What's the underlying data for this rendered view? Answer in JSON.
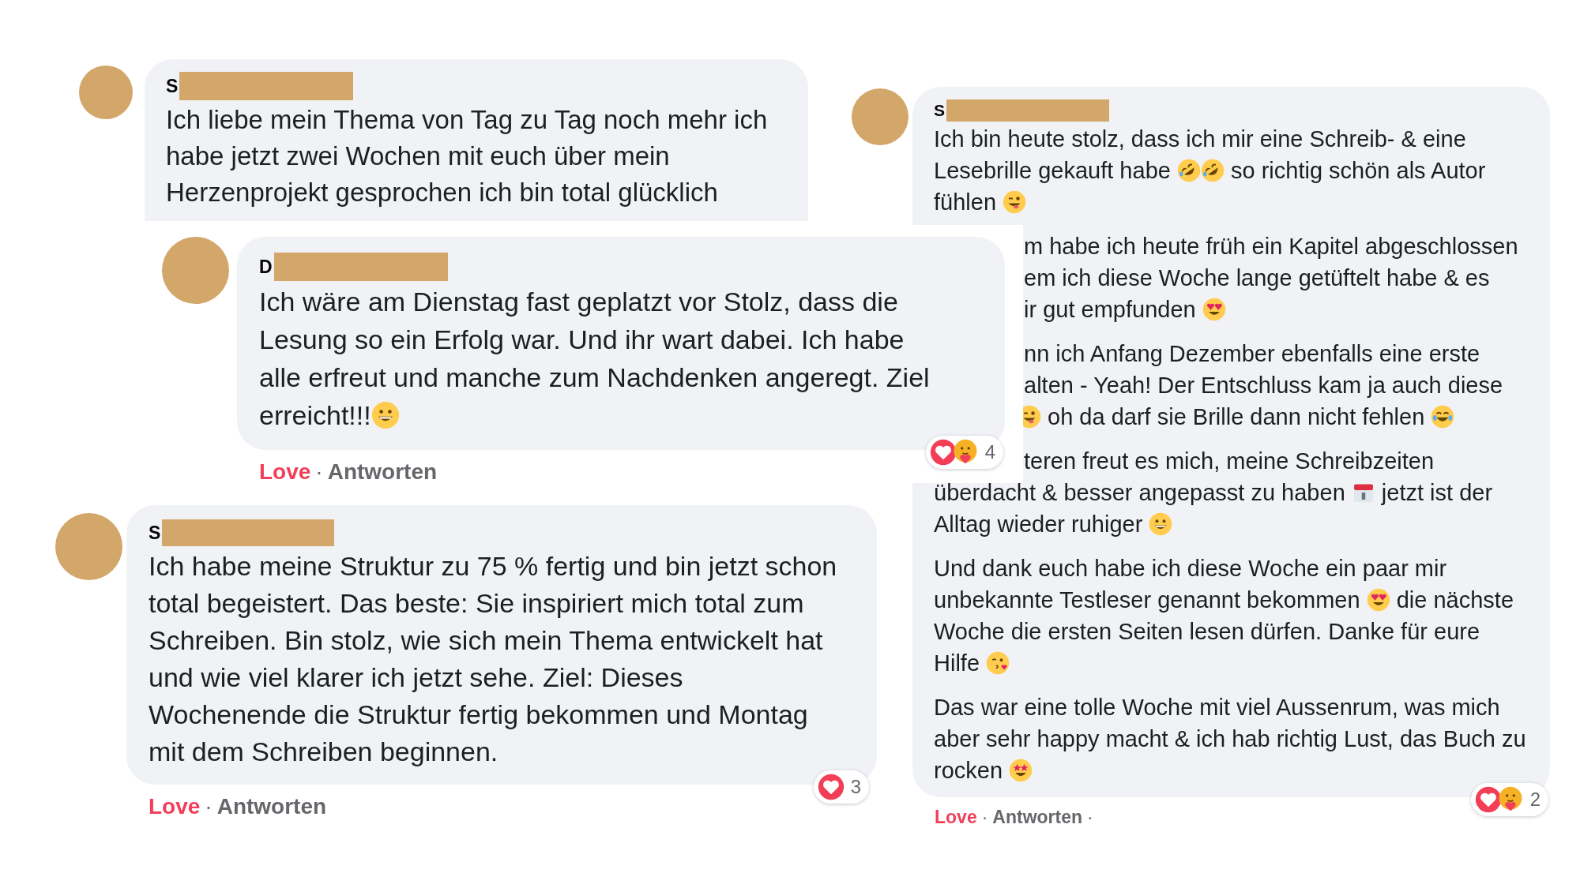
{
  "comments": [
    {
      "author": "S",
      "paragraphs": [
        {
          "lines": [
            {
              "segments": [
                {
                  "text": "Ich liebe mein Thema von Tag zu Tag noch mehr ich"
                }
              ]
            },
            {
              "segments": [
                {
                  "text": "habe jetzt zwei Wochen mit euch über mein"
                }
              ]
            },
            {
              "segments": [
                {
                  "text": "Herzenprojekt gesprochen ich bin total glücklich"
                }
              ]
            }
          ]
        }
      ]
    },
    {
      "author": "D",
      "paragraphs": [
        {
          "lines": [
            {
              "segments": [
                {
                  "text": "Ich wäre am Dienstag fast geplatzt vor Stolz, dass die"
                }
              ]
            },
            {
              "segments": [
                {
                  "text": "Lesung so ein Erfolg war. Und ihr wart dabei. Ich habe"
                }
              ]
            },
            {
              "segments": [
                {
                  "text": "alle erfreut und manche zum Nachdenken angeregt. Ziel"
                }
              ]
            },
            {
              "segments": [
                {
                  "text": "erreicht!!!"
                },
                {
                  "kind": "grin"
                }
              ]
            }
          ]
        }
      ],
      "actions": [
        {
          "kind": "reaction",
          "text": "Love"
        },
        {
          "kind": "dot",
          "text": "·"
        },
        {
          "kind": "link",
          "text": "Antworten"
        }
      ],
      "reactions": {
        "icons": [
          {
            "kind": "love"
          },
          {
            "kind": "care"
          }
        ],
        "count": "4"
      }
    },
    {
      "author": "S",
      "paragraphs": [
        {
          "lines": [
            {
              "segments": [
                {
                  "text": "Ich habe meine Struktur zu 75 % fertig und bin jetzt schon"
                }
              ]
            },
            {
              "segments": [
                {
                  "text": "total begeistert. Das beste: Sie inspiriert mich total zum"
                }
              ]
            },
            {
              "segments": [
                {
                  "text": "Schreiben. Bin stolz, wie sich mein Thema entwickelt hat"
                }
              ]
            },
            {
              "segments": [
                {
                  "text": "und wie viel klarer ich jetzt sehe. Ziel: Dieses"
                }
              ]
            },
            {
              "segments": [
                {
                  "text": "Wochenende die Struktur fertig bekommen und Montag"
                }
              ]
            },
            {
              "segments": [
                {
                  "text": "mit dem Schreiben beginnen."
                }
              ]
            }
          ]
        }
      ],
      "actions": [
        {
          "kind": "reaction",
          "text": "Love"
        },
        {
          "kind": "dot",
          "text": "·"
        },
        {
          "kind": "link",
          "text": "Antworten"
        }
      ],
      "reactions": {
        "icons": [
          {
            "kind": "love"
          }
        ],
        "count": "3"
      }
    },
    {
      "author": "S",
      "paragraphs": [
        {
          "lines": [
            {
              "segments": [
                {
                  "text": "Ich bin heute stolz, dass ich mir eine Schreib- & eine"
                }
              ]
            },
            {
              "segments": [
                {
                  "text": "Lesebrille gekauft habe "
                },
                {
                  "kind": "rofl"
                },
                {
                  "kind": "rofl"
                },
                {
                  "text": " so richtig schön als Autor"
                }
              ]
            },
            {
              "segments": [
                {
                  "text": "fühlen "
                },
                {
                  "kind": "wink"
                }
              ]
            }
          ]
        },
        {
          "lines": [
            {
              "cut": true,
              "segments": [
                {
                  "text": "m habe ich heute früh ein Kapitel abgeschlossen"
                }
              ]
            },
            {
              "cut": true,
              "segments": [
                {
                  "text": "em ich diese Woche lange getüftelt habe & es"
                }
              ]
            },
            {
              "cut": true,
              "segments": [
                {
                  "text": "ir gut empfunden "
                },
                {
                  "kind": "hearteyes"
                }
              ]
            }
          ]
        },
        {
          "lines": [
            {
              "cut": true,
              "segments": [
                {
                  "text": "nn ich Anfang Dezember ebenfalls eine erste"
                }
              ]
            },
            {
              "cut": true,
              "segments": [
                {
                  "text": "alten - Yeah! Der Entschluss kam ja auch diese"
                }
              ]
            },
            {
              "cut": true,
              "segments": [
                {
                  "kind": "wink"
                },
                {
                  "text": " oh da darf sie Brille dann nicht fehlen "
                },
                {
                  "kind": "tears"
                }
              ]
            }
          ]
        },
        {
          "lines": [
            {
              "cut": true,
              "segments": [
                {
                  "text": "teren freut es mich, meine Schreibzeiten"
                }
              ]
            },
            {
              "segments": [
                {
                  "text": "überdacht & besser angepasst zu haben "
                },
                {
                  "kind": "calendar"
                },
                {
                  "text": " jetzt ist der"
                }
              ]
            },
            {
              "segments": [
                {
                  "text": "Alltag wieder ruhiger "
                },
                {
                  "kind": "grin"
                }
              ]
            }
          ]
        },
        {
          "lines": [
            {
              "segments": [
                {
                  "text": "Und dank euch habe ich diese Woche ein paar mir"
                }
              ]
            },
            {
              "segments": [
                {
                  "text": "unbekannte Testleser genannt bekommen "
                },
                {
                  "kind": "hearteyes"
                },
                {
                  "text": " die nächste"
                }
              ]
            },
            {
              "segments": [
                {
                  "text": "Woche die ersten Seiten lesen dürfen. Danke für eure"
                }
              ]
            },
            {
              "segments": [
                {
                  "text": "Hilfe "
                },
                {
                  "kind": "kiss"
                }
              ]
            }
          ]
        },
        {
          "lines": [
            {
              "segments": [
                {
                  "text": "Das war eine tolle Woche mit viel Aussenrum, was mich"
                }
              ]
            },
            {
              "segments": [
                {
                  "text": "aber sehr happy macht & ich hab richtig Lust, das Buch zu"
                }
              ]
            },
            {
              "segments": [
                {
                  "text": "rocken "
                },
                {
                  "kind": "starstruck"
                }
              ]
            }
          ]
        }
      ],
      "actions": [
        {
          "kind": "reaction",
          "text": "Love"
        },
        {
          "kind": "dot",
          "text": "·"
        },
        {
          "kind": "link",
          "text": "Antworten"
        },
        {
          "kind": "dot",
          "text": "·"
        }
      ],
      "reactions": {
        "icons": [
          {
            "kind": "love"
          },
          {
            "kind": "care"
          }
        ],
        "count": "2"
      }
    }
  ]
}
